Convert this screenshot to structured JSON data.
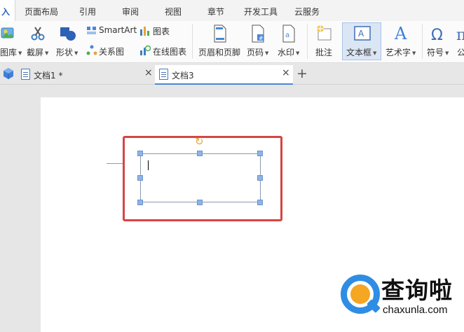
{
  "menubar": {
    "active_tab": "入",
    "tabs": [
      "页面布局",
      "引用",
      "审阅",
      "视图",
      "章节",
      "开发工具",
      "云服务"
    ]
  },
  "ribbon": {
    "gallery_label": "图库",
    "screenshot_label": "截屏",
    "shapes_label": "形状",
    "smartart_label": "SmartArt",
    "chart_label": "图表",
    "relation_label": "关系图",
    "online_chart_label": "在线图表",
    "header_footer_label": "页眉和页脚",
    "page_number_label": "页码",
    "watermark_label": "水印",
    "comment_label": "批注",
    "textbox_label": "文本框",
    "wordart_label": "艺术字",
    "symbol_label": "符号",
    "formula_label": "公"
  },
  "doc_tabs": [
    {
      "label": "文档1 *"
    },
    {
      "label": "文档3"
    }
  ],
  "watermark": {
    "name": "查询啦",
    "url": "chaxunla.com"
  },
  "colors": {
    "highlight_border": "#d64543",
    "accent_blue": "#2a60b8",
    "logo_blue": "#2f8de4",
    "logo_orange": "#f5a623"
  }
}
